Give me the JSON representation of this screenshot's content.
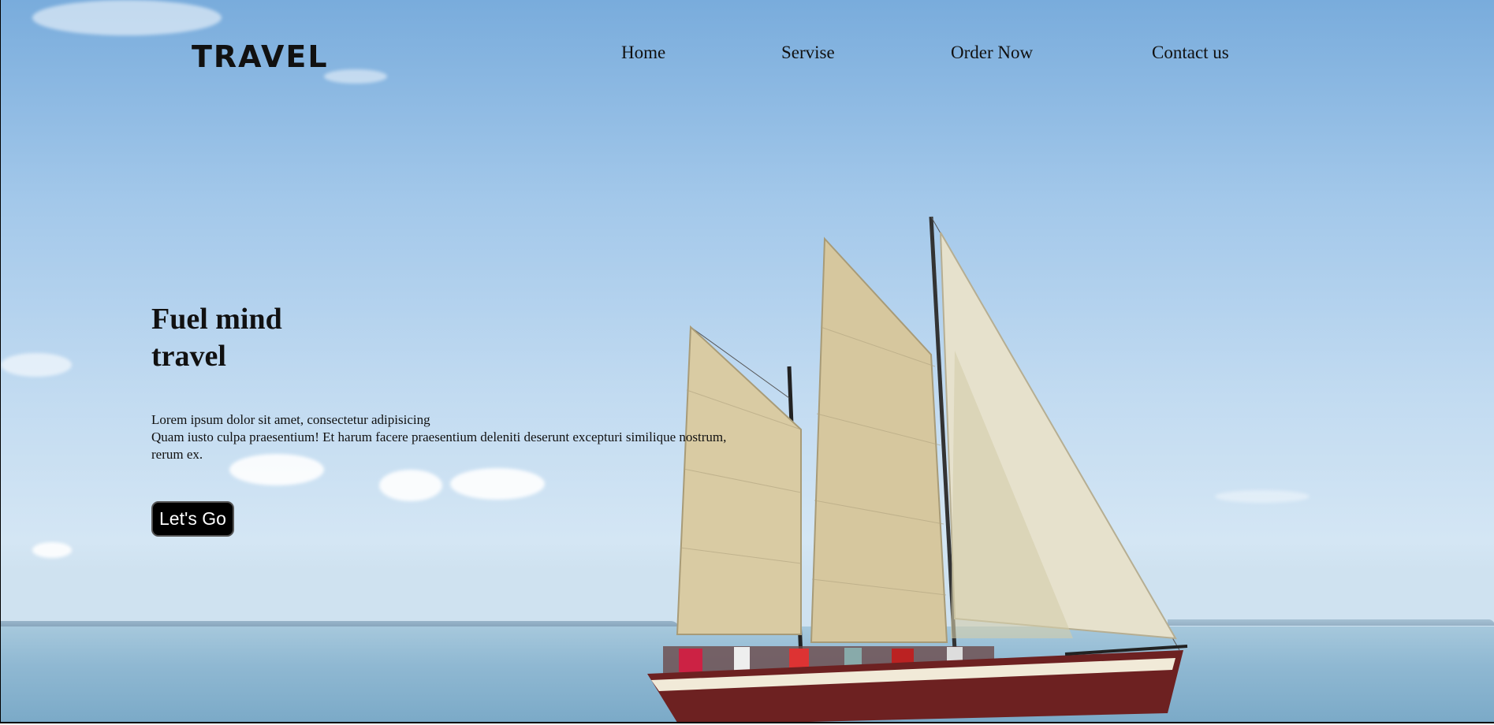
{
  "header": {
    "logo": "TRAVEL",
    "nav": [
      {
        "label": "Home"
      },
      {
        "label": "Servise"
      },
      {
        "label": "Order Now"
      },
      {
        "label": "Contact us"
      }
    ]
  },
  "hero": {
    "title_line1": "Fuel mind",
    "title_line2": "travel",
    "text_line1": "Lorem ipsum dolor sit amet, consectetur adipisicing",
    "text_line2": "Quam iusto culpa praesentium! Et harum facere praesentium deleniti deserunt excepturi similique nostrum,",
    "text_line3": "rerum ex.",
    "button_label": "Let's Go"
  },
  "colors": {
    "sky": "#a3c8ea",
    "sea": "#8fb8d2",
    "text": "#111111",
    "button_bg": "#000000",
    "button_text": "#ffffff",
    "sail": "#d9cba3"
  },
  "background": {
    "icon": "sailboat-image"
  }
}
